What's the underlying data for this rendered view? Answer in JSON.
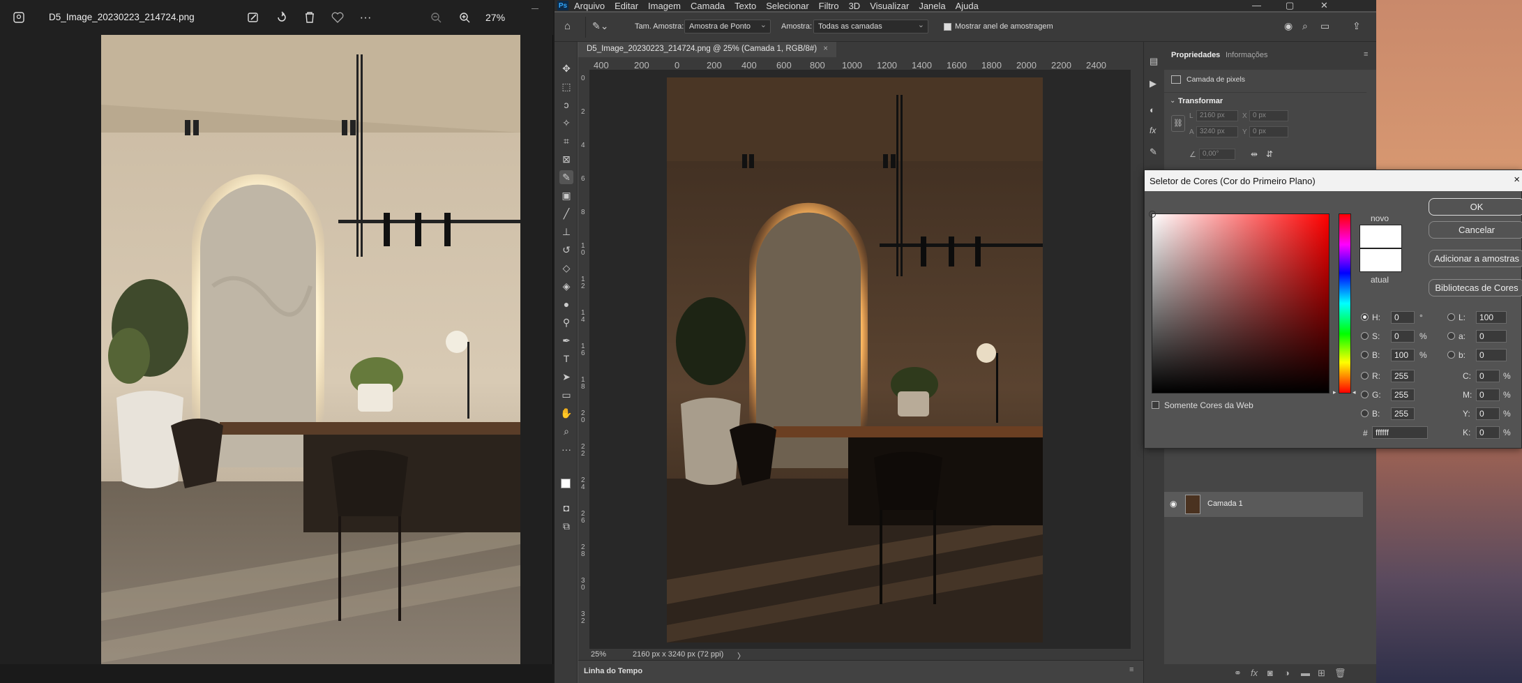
{
  "viewer": {
    "filename": "D5_Image_20230223_214724.png",
    "zoom": "27%",
    "toolbar_icons": [
      "edit-image-icon",
      "rotate-icon",
      "delete-icon",
      "favorite-icon",
      "more-icon"
    ],
    "zoom_icons": [
      "zoom-out-icon",
      "zoom-in-icon"
    ]
  },
  "ps": {
    "menu": [
      "Arquivo",
      "Editar",
      "Imagem",
      "Camada",
      "Texto",
      "Selecionar",
      "Filtro",
      "3D",
      "Visualizar",
      "Janela",
      "Ajuda"
    ],
    "options": {
      "sample_size_label": "Tam. Amostra:",
      "sample_size_value": "Amostra de Ponto",
      "sample_label": "Amostra:",
      "sample_value": "Todas as camadas",
      "show_ring_label": "Mostrar anel de amostragem"
    },
    "doc_tab": "D5_Image_20230223_214724.png @ 25% (Camada 1, RGB/8#)",
    "doc_tab_close": "×",
    "ruler_h": [
      "400",
      "200",
      "0",
      "200",
      "400",
      "600",
      "800",
      "1000",
      "1200",
      "1400",
      "1600",
      "1800",
      "2000",
      "2200",
      "2400"
    ],
    "ruler_v": [
      "0",
      "2",
      "4",
      "6",
      "8",
      "1\n0",
      "1\n2",
      "1\n4",
      "1\n6",
      "1\n8",
      "2\n0",
      "2\n2",
      "2\n4",
      "2\n6",
      "2\n8",
      "3\n0",
      "3\n2"
    ],
    "status_zoom": "25%",
    "status_info": "2160 px x 3240 px (72 ppi)",
    "status_arrow": "〉",
    "timeline_label": "Linha do Tempo",
    "properties": {
      "tab_active": "Propriedades",
      "tab_other": "Informações",
      "layer_type": "Camada de pixels",
      "transform_header": "Transformar",
      "l_label": "L",
      "l_value": "2160 px",
      "a_label": "A",
      "a_value": "3240 px",
      "x_label": "X",
      "x_value": "0 px",
      "y_label": "Y",
      "y_value": "0 px",
      "angle_value": "0,00°"
    },
    "layer_name": "Camada 1"
  },
  "picker": {
    "title": "Seletor de Cores (Cor do Primeiro Plano)",
    "close": "×",
    "buttons": {
      "ok": "OK",
      "cancel": "Cancelar",
      "add": "Adicionar a amostras",
      "libraries": "Bibliotecas de Cores"
    },
    "new_label": "novo",
    "current_label": "atual",
    "web_only_label": "Somente Cores da Web",
    "fields": {
      "H": {
        "label": "H:",
        "value": "0",
        "unit": "°"
      },
      "S": {
        "label": "S:",
        "value": "0",
        "unit": "%"
      },
      "Bv": {
        "label": "B:",
        "value": "100",
        "unit": "%"
      },
      "R": {
        "label": "R:",
        "value": "255"
      },
      "G": {
        "label": "G:",
        "value": "255"
      },
      "B": {
        "label": "B:",
        "value": "255"
      },
      "L": {
        "label": "L:",
        "value": "100"
      },
      "a": {
        "label": "a:",
        "value": "0"
      },
      "b": {
        "label": "b:",
        "value": "0"
      },
      "C": {
        "label": "C:",
        "value": "0",
        "unit": "%"
      },
      "M": {
        "label": "M:",
        "value": "0",
        "unit": "%"
      },
      "Y": {
        "label": "Y:",
        "value": "0",
        "unit": "%"
      },
      "K": {
        "label": "K:",
        "value": "0",
        "unit": "%"
      }
    },
    "hex_label": "#",
    "hex_value": "ffffff",
    "selected_color": "#ffffff"
  }
}
